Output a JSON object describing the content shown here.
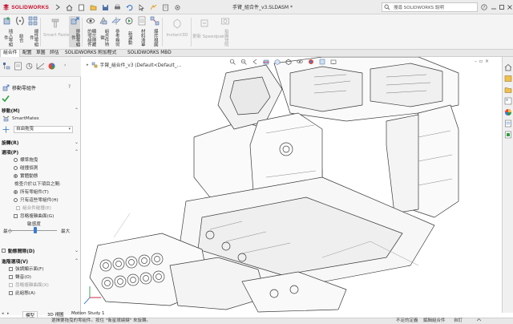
{
  "app": {
    "logo_text": "SOLIDWORKS",
    "window_title": "手臂_組合件_v3.SLDASM *",
    "search_placeholder": "搜尋 SOLIDWORKS 說明"
  },
  "ribbon": {
    "buttons": [
      {
        "label": "插入零組件",
        "icon": "insert-component-icon"
      },
      {
        "label": "結合",
        "icon": "mate-icon"
      },
      {
        "label": "線性零組件",
        "icon": "linear-pattern-icon"
      },
      {
        "label": "Smart Fasteners",
        "icon": "smart-fasteners-icon"
      },
      {
        "label": "移動零組件",
        "icon": "move-component-icon"
      },
      {
        "label": "顯示隱藏的零組件",
        "icon": "show-hidden-icon"
      },
      {
        "label": "組合件特徵",
        "icon": "assembly-feature-icon"
      },
      {
        "label": "參考幾何",
        "icon": "reference-geometry-icon"
      },
      {
        "label": "新運動",
        "icon": "new-motion-icon"
      },
      {
        "label": "材料清單",
        "icon": "bom-icon"
      },
      {
        "label": "爆炸視圖",
        "icon": "exploded-view-icon"
      },
      {
        "label": "Instant3D",
        "icon": "instant3d-icon"
      },
      {
        "label": "更新 Speedpak",
        "icon": "speedpak-icon"
      },
      {
        "label": "拍攝快照",
        "icon": "snapshot-icon"
      }
    ]
  },
  "tabs": [
    "組合件",
    "配置",
    "草圖",
    "評估",
    "SOLIDWORKS 附加程式",
    "SOLIDWORKS MBD"
  ],
  "panel": {
    "title": "移動零組件",
    "move_header": "移動(M)",
    "smartmates": "SmartMates",
    "move_mode": "自由拖曳",
    "rotate_header": "旋轉(R)",
    "options_header": "選項(P)",
    "options": [
      {
        "label": "標準拖曳",
        "state": "off"
      },
      {
        "label": "碰撞偵測",
        "state": "off"
      },
      {
        "label": "實體動態",
        "state": "on"
      }
    ],
    "check_between": "檢查介於以下項目之間:",
    "scope": [
      {
        "label": "所有零組件(T)",
        "state": "on"
      },
      {
        "label": "只有這些零組件(H)",
        "state": "off"
      }
    ],
    "sub_check": "組合件碰撞(E)",
    "ignore_check": "忽略複雜曲面(G)",
    "sensitivity_label": "敏感度",
    "min_label": "最小",
    "max_label": "最大",
    "sensitivity": 0.55,
    "dynamic_header": "動態間隙(D)",
    "advanced_header": "進階選項(V)",
    "advanced": [
      {
        "label": "強調顯示面(F)",
        "checked": true
      },
      {
        "label": "聲音(O)",
        "checked": false
      },
      {
        "label": "忽略複雜曲面(X)",
        "checked": false
      },
      {
        "label": "此組態(A)",
        "checked": false
      }
    ]
  },
  "viewport": {
    "tree_label": "手臂_組合件_v3 (Default<Default_..."
  },
  "bottom_tabs": [
    "模型",
    "3D 視圖",
    "Motion Study 1"
  ],
  "status": {
    "message": "選擇要拖曳的零組件。按住 \"衛星環繞鍵\" 來旋轉。",
    "right1": "不足的定義",
    "right2": "編輯組合件",
    "right3": "自訂"
  },
  "colors": {
    "accent": "#3a7bd5",
    "logo_red": "#c8102e",
    "ok_green": "#2e9e3f"
  }
}
